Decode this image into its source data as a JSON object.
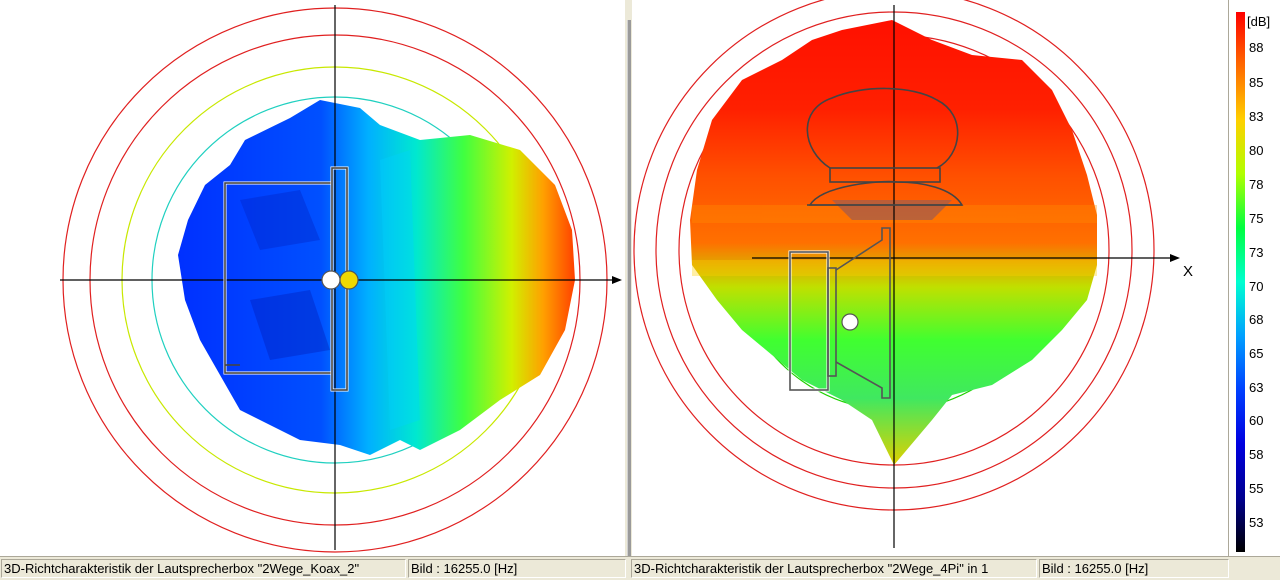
{
  "left_view": {
    "status_title": "3D-Richtcharakteristik der Lautsprecherbox \"2Wege_Koax_2\"",
    "status_frame": "Bild : 16255.0 [Hz]"
  },
  "right_view": {
    "status_title": "3D-Richtcharakteristik der Lautsprecherbox \"2Wege_4Pi\" in 1",
    "status_frame": "Bild : 16255.0 [Hz]",
    "axis_label": "X"
  },
  "colorbar": {
    "unit": "[dB]",
    "ticks": [
      "88",
      "85",
      "83",
      "80",
      "78",
      "75",
      "73",
      "70",
      "68",
      "65",
      "63",
      "60",
      "58",
      "55",
      "53"
    ],
    "colors": [
      "#ff0000",
      "#ff6000",
      "#ffd000",
      "#b0ff00",
      "#00ff40",
      "#00ffd0",
      "#00a0ff",
      "#0040ff",
      "#0000e0",
      "#000090",
      "#000000"
    ]
  },
  "icons": {
    "listener_marker_left": "white-circle-icon",
    "listener_marker_left_2": "yellow-circle-icon",
    "listener_marker_right": "white-circle-icon"
  }
}
